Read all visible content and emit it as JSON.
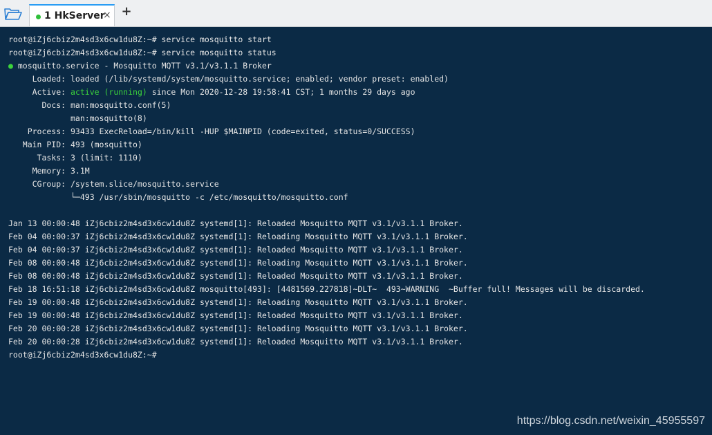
{
  "tabbar": {
    "folder_icon": "folder-open-icon",
    "tab_label": "1 HkServer",
    "close_glyph": "×",
    "new_tab_glyph": "+"
  },
  "terminal": {
    "lines": [
      "root@iZj6cbiz2m4sd3x6cw1du8Z:~# service mosquitto start",
      "root@iZj6cbiz2m4sd3x6cw1du8Z:~# service mosquitto status",
      "● mosquitto.service - Mosquitto MQTT v3.1/v3.1.1 Broker",
      "     Loaded: loaded (/lib/systemd/system/mosquitto.service; enabled; vendor preset: enabled)",
      "     Active: active (running) since Mon 2020-12-28 19:58:41 CST; 1 months 29 days ago",
      "       Docs: man:mosquitto.conf(5)",
      "             man:mosquitto(8)",
      "    Process: 93433 ExecReload=/bin/kill -HUP $MAINPID (code=exited, status=0/SUCCESS)",
      "   Main PID: 493 (mosquitto)",
      "      Tasks: 3 (limit: 1110)",
      "     Memory: 3.1M",
      "     CGroup: /system.slice/mosquitto.service",
      "             └─493 /usr/sbin/mosquitto -c /etc/mosquitto/mosquitto.conf",
      "",
      "Jan 13 00:00:48 iZj6cbiz2m4sd3x6cw1du8Z systemd[1]: Reloaded Mosquitto MQTT v3.1/v3.1.1 Broker.",
      "Feb 04 00:00:37 iZj6cbiz2m4sd3x6cw1du8Z systemd[1]: Reloading Mosquitto MQTT v3.1/v3.1.1 Broker.",
      "Feb 04 00:00:37 iZj6cbiz2m4sd3x6cw1du8Z systemd[1]: Reloaded Mosquitto MQTT v3.1/v3.1.1 Broker.",
      "Feb 08 00:00:48 iZj6cbiz2m4sd3x6cw1du8Z systemd[1]: Reloading Mosquitto MQTT v3.1/v3.1.1 Broker.",
      "Feb 08 00:00:48 iZj6cbiz2m4sd3x6cw1du8Z systemd[1]: Reloaded Mosquitto MQTT v3.1/v3.1.1 Broker.",
      "Feb 18 16:51:18 iZj6cbiz2m4sd3x6cw1du8Z mosquitto[493]: [4481569.227818]~DLT~  493~WARNING  ~Buffer full! Messages will be discarded.",
      "Feb 19 00:00:48 iZj6cbiz2m4sd3x6cw1du8Z systemd[1]: Reloading Mosquitto MQTT v3.1/v3.1.1 Broker.",
      "Feb 19 00:00:48 iZj6cbiz2m4sd3x6cw1du8Z systemd[1]: Reloaded Mosquitto MQTT v3.1/v3.1.1 Broker.",
      "Feb 20 00:00:28 iZj6cbiz2m4sd3x6cw1du8Z systemd[1]: Reloading Mosquitto MQTT v3.1/v3.1.1 Broker.",
      "Feb 20 00:00:28 iZj6cbiz2m4sd3x6cw1du8Z systemd[1]: Reloaded Mosquitto MQTT v3.1/v3.1.1 Broker.",
      "root@iZj6cbiz2m4sd3x6cw1du8Z:~#"
    ],
    "status_dot": "●",
    "active_prefix": "     Active: ",
    "active_state": "active (running)",
    "active_suffix": " since Mon 2020-12-28 19:58:41 CST; 1 months 29 days ago",
    "unit_rest": " mosquitto.service - Mosquitto MQTT v3.1/v3.1.1 Broker"
  },
  "watermark": "https://blog.csdn.net/weixin_45955597",
  "colors": {
    "terminal_bg": "#0b2a45",
    "text": "#e6e6e6",
    "status_green": "#3cd33c",
    "tab_accent": "#2a9df4"
  }
}
